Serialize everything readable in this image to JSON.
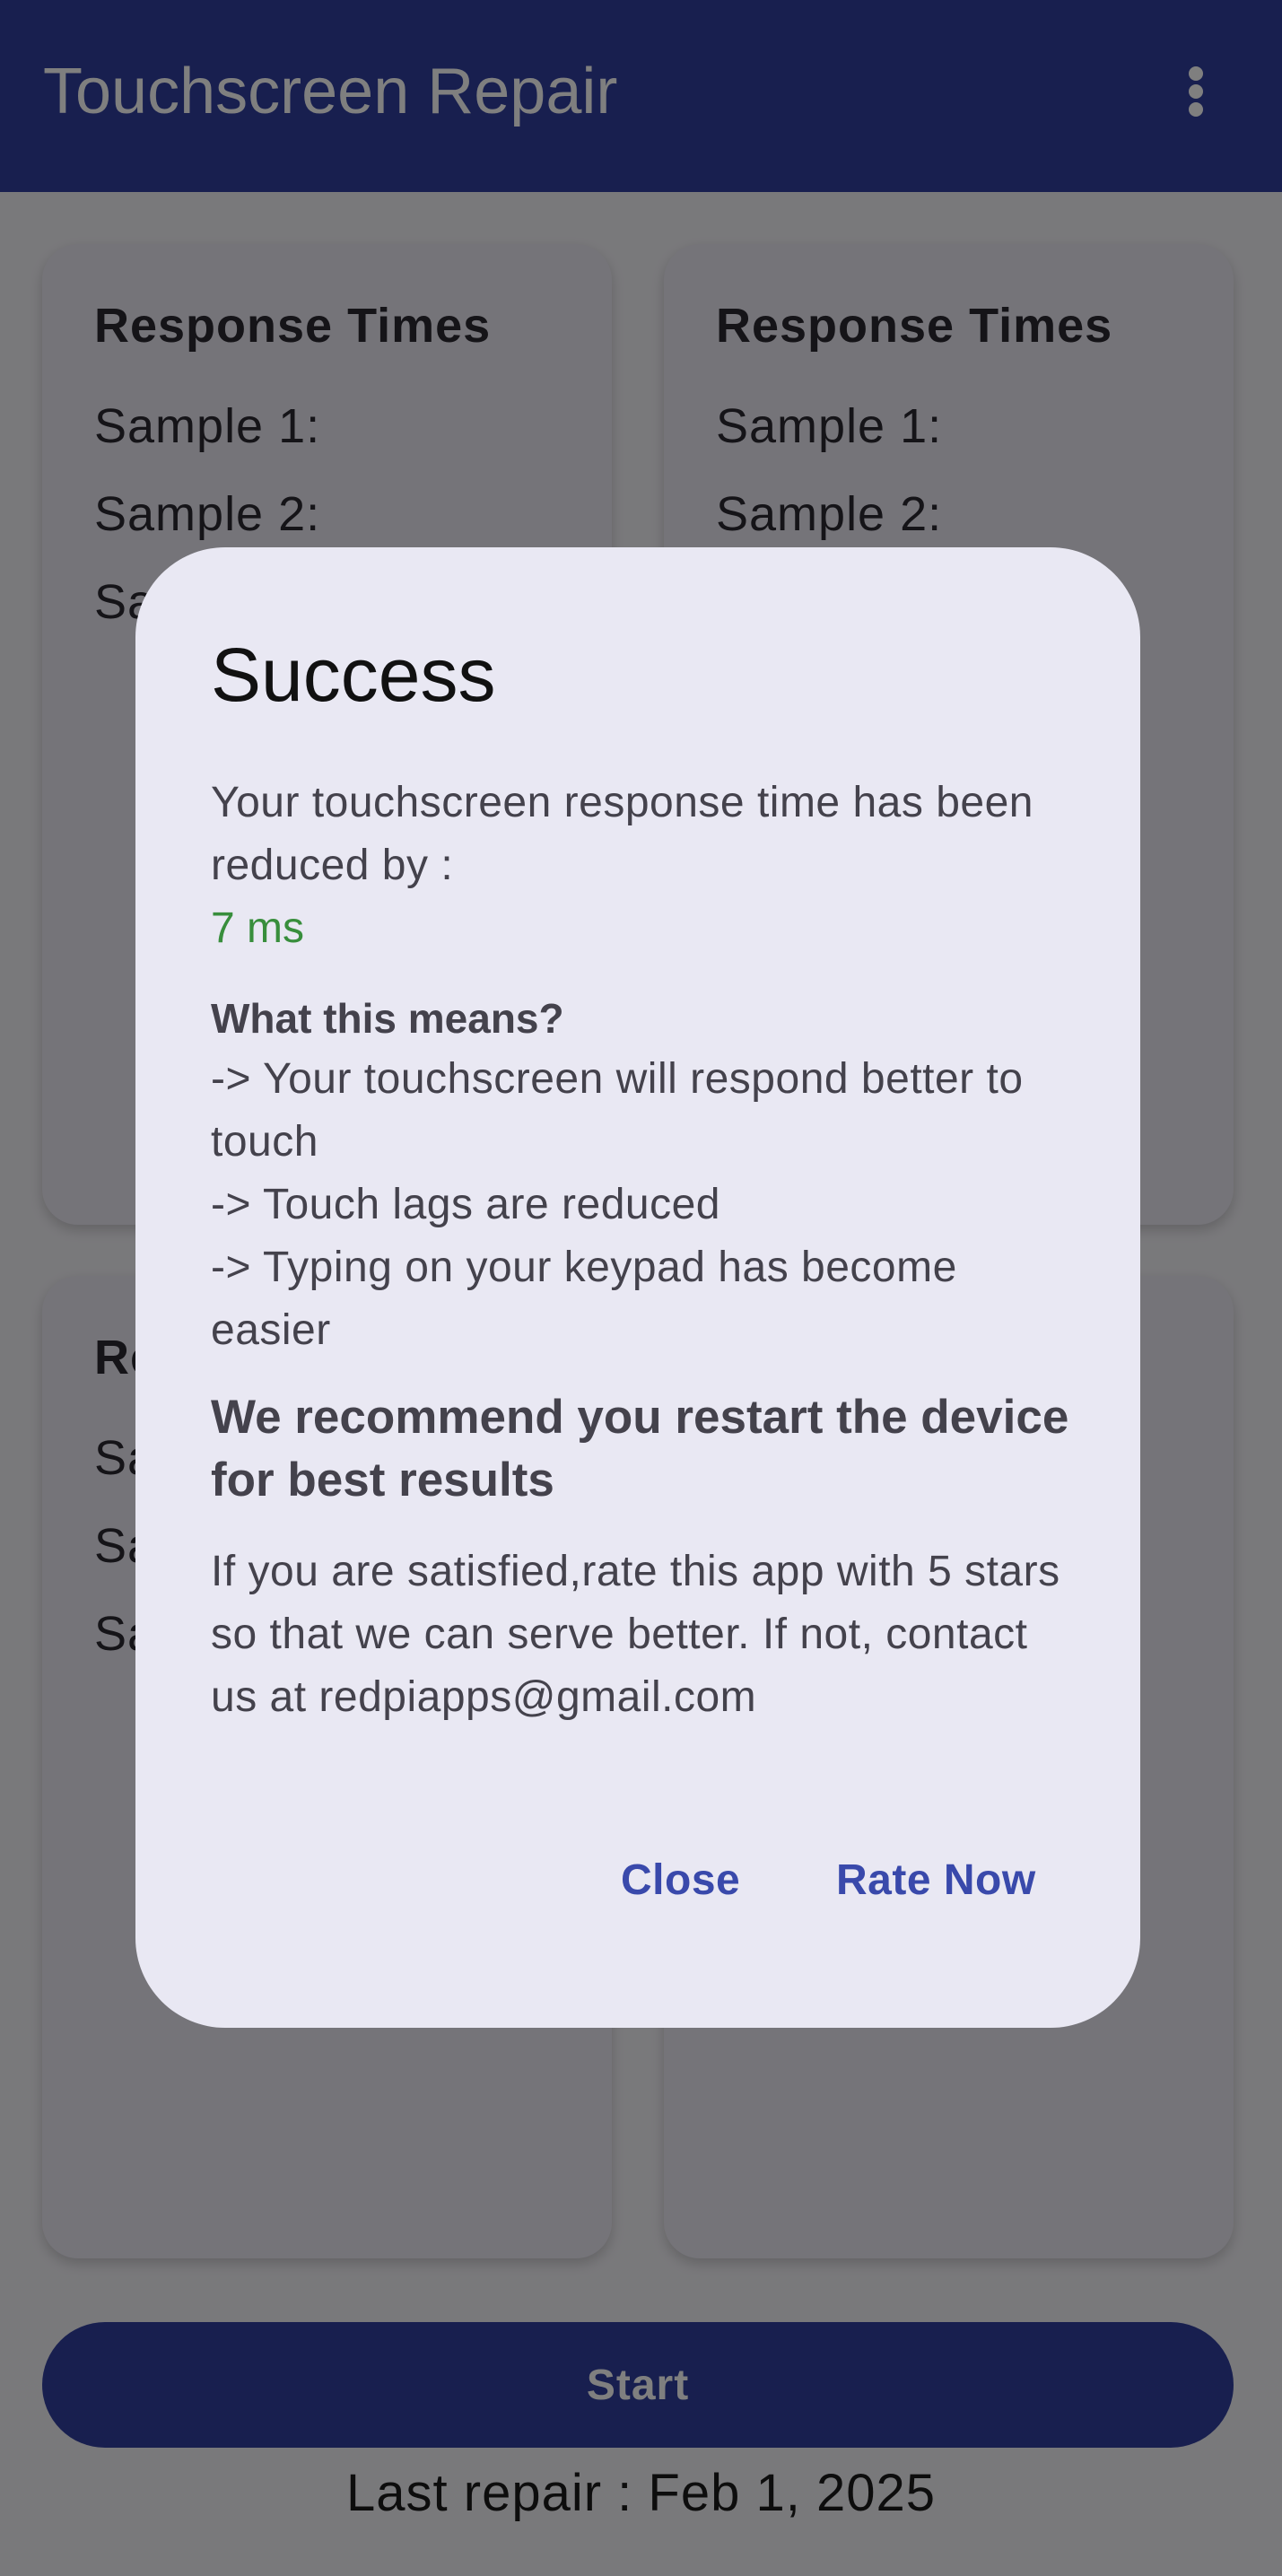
{
  "app_bar": {
    "title": "Touchscreen Repair",
    "overflow_icon": "more-vert-icon"
  },
  "cards": [
    {
      "title": "Response Times",
      "lines": [
        "Sample 1:",
        "Sample 2:",
        "Sa"
      ]
    },
    {
      "title": "Response Times",
      "lines": [
        "Sample 1:",
        "Sample 2:"
      ]
    },
    {
      "title": "Re",
      "lines": [
        "Sa",
        "Sa",
        "Sa"
      ]
    }
  ],
  "start_button": {
    "label": "Start"
  },
  "last_repair": {
    "label": "Last repair :",
    "date": "Feb 1, 2025"
  },
  "dialog": {
    "title": "Success",
    "intro": "Your touchscreen response time has been reduced by :",
    "reduction": "7 ms",
    "meaning_heading": "What this means?",
    "meaning_lines": [
      "-> Your touchscreen will respond better to touch",
      "-> Touch lags are reduced",
      "-> Typing on your keypad has become easier"
    ],
    "recommendation": "We recommend you restart the device for best results",
    "rate_text": "If you are satisfied,rate this app with 5 stars so that we can serve better. If not, contact us at redpiapps@gmail.com",
    "close_label": "Close",
    "rate_label": "Rate Now"
  },
  "colors": {
    "primary": "#303f9f",
    "accent_text": "#3949ab",
    "success": "#388e3c",
    "dialog_bg": "#e9e8f3"
  }
}
